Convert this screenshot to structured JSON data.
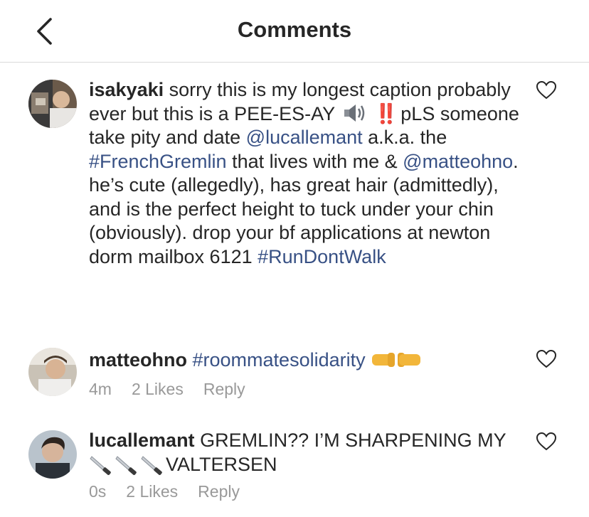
{
  "header": {
    "title": "Comments",
    "back_icon": "chevron-left-icon"
  },
  "caption": {
    "username": "isakyaki",
    "text_1": " sorry this is my longest caption probably ever but this is a PEE-ES-AY ",
    "speaker_icon": "speaker-emoji-icon",
    "bang": "‼️",
    "text_2": " pLS someone take pity and date ",
    "mention_1": "@lucallemant",
    "text_3": " a.k.a. the ",
    "hashtag_1": "#FrenchGremlin",
    "text_4": " that lives with me & ",
    "mention_2": "@matteohno",
    "text_5": ". he’s cute (allegedly), has great hair (admittedly), and is the perfect height to tuck under your chin (obviously). drop your bf applications at newton dorm mailbox 6121 ",
    "hashtag_2": "#RunDontWalk",
    "like_icon": "heart-outline-icon"
  },
  "comments": [
    {
      "username": "matteohno",
      "hashtag": "#roommatesolidarity",
      "emoji": "fist-bump-emoji-icon",
      "time": "4m",
      "likes": "2 Likes",
      "reply": "Reply",
      "like_icon": "heart-outline-icon"
    },
    {
      "username": "lucallemant",
      "text_1": " GREMLIN?? I’M SHARPENING MY ",
      "emoji": "knife-emoji-icon",
      "text_2": "VALTERSEN",
      "time": "0s",
      "likes": "2 Likes",
      "reply": "Reply",
      "like_icon": "heart-outline-icon"
    }
  ]
}
